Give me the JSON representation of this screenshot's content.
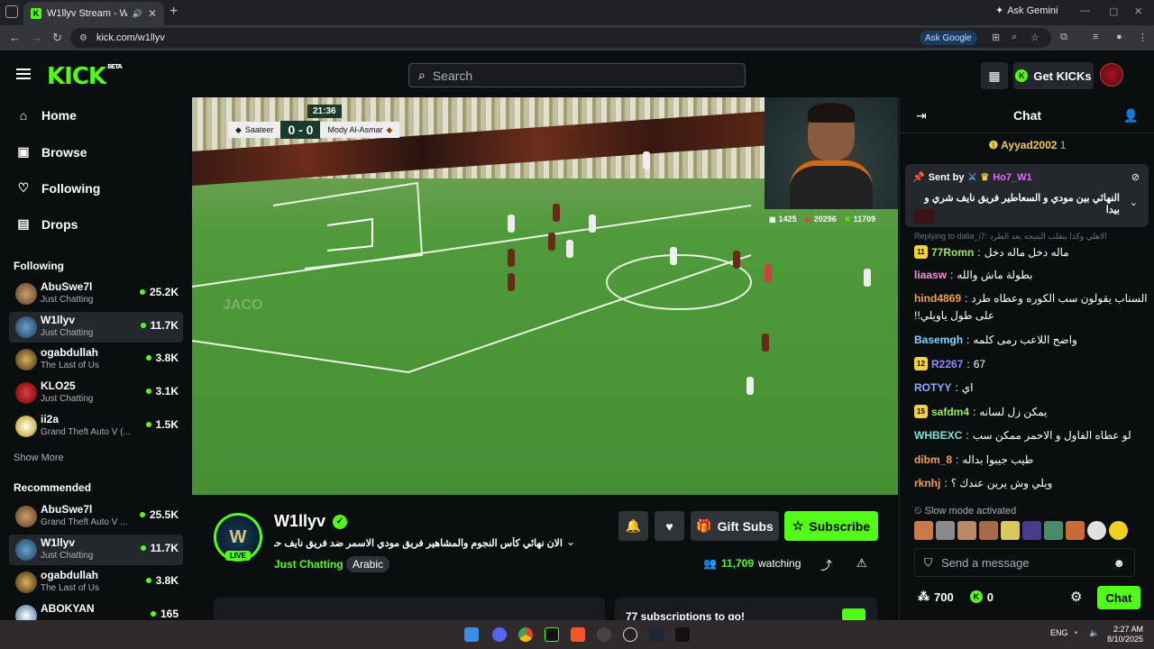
{
  "browser": {
    "tab_title": "W1llyv Stream - Watch Live",
    "ask_gemini": "Ask Gemini",
    "url": "kick.com/w1llyv",
    "ask_google": "Ask Google"
  },
  "header": {
    "logo": "KICK",
    "logo_beta": "BETA",
    "search_placeholder": "Search",
    "get_kicks": "Get KICKs"
  },
  "sidebar": {
    "nav": [
      {
        "label": "Home",
        "icon": "home-icon"
      },
      {
        "label": "Browse",
        "icon": "browse-icon"
      },
      {
        "label": "Following",
        "icon": "heart-icon"
      },
      {
        "label": "Drops",
        "icon": "drops-icon"
      }
    ],
    "following_title": "Following",
    "following": [
      {
        "name": "AbuSwe7l",
        "category": "Just Chatting",
        "viewers": "25.2K"
      },
      {
        "name": "W1llyv",
        "category": "Just Chatting",
        "viewers": "11.7K"
      },
      {
        "name": "ogabdullah",
        "category": "The Last of Us",
        "viewers": "3.8K"
      },
      {
        "name": "KLO25",
        "category": "Just Chatting",
        "viewers": "3.1K"
      },
      {
        "name": "ii2a",
        "category": "Grand Theft Auto V (...",
        "viewers": "1.5K"
      }
    ],
    "show_more": "Show More",
    "recommended_title": "Recommended",
    "recommended": [
      {
        "name": "AbuSwe7l",
        "category": "Grand Theft Auto V ...",
        "viewers": "25.5K"
      },
      {
        "name": "W1llyv",
        "category": "Just Chatting",
        "viewers": "11.7K"
      },
      {
        "name": "ogabdullah",
        "category": "The Last of Us",
        "viewers": "3.8K"
      },
      {
        "name": "ABOKYAN",
        "category": "",
        "viewers": "165"
      }
    ]
  },
  "video": {
    "clock": "21:36",
    "team_home": "Saateer",
    "score": "0 - 0",
    "team_away": "Mody Al-Asmar",
    "stat_1": "1425",
    "stat_2": "20296",
    "stat_3": "11709",
    "watermark": "JACO"
  },
  "stream": {
    "avatar_initial": "W",
    "live": "LIVE",
    "name": "W1llyv",
    "title": "الان نهائي كأس النجوم والمشاهير فريق مودي الاسمر ضد فريق نايف حمدان ...",
    "category": "Just Chatting",
    "tag": "Arabic",
    "gift_subs": "Gift Subs",
    "subscribe": "Subscribe",
    "viewers": "11,709",
    "watching_label": "watching",
    "panel_text": "77 subscriptions to go!"
  },
  "chat": {
    "title": "Chat",
    "top_gifter": "Ayyad2002",
    "top_gifter_count": "1",
    "pinned_sent_by": "Sent by",
    "pinned_user": "Ho7_W1",
    "pinned_msg": "النهائي بين مودي و السعاطير فريق نايف شري و بيدا",
    "reply_to": "Replying to dalia_i7: الاهلي وكذا بنقلب النتيجه بعد الطرد",
    "messages": [
      {
        "badge": "11",
        "user": "77Romn",
        "color": "#9be564",
        "text": "ماله دخل ماله دخل"
      },
      {
        "badge": "",
        "user": "liaasw",
        "color": "#ff8ad8",
        "text": "بطولة ماش والله"
      },
      {
        "badge": "",
        "user": "hind4869",
        "color": "#f0a04b",
        "text": "شفت السناب يقولون سب الكوره وعطاه طرد"
      },
      {
        "badge": "",
        "user": "",
        "color": "#ffffff",
        "text": "!!على طول ياويلي"
      },
      {
        "badge": "",
        "user": "Basemgh",
        "color": "#7fd3ff",
        "text": "واضح اللاعب رمى كلمه"
      },
      {
        "badge": "12",
        "user": "R2267",
        "color": "#8c8cff",
        "text": "67"
      },
      {
        "badge": "",
        "user": "ROTYY",
        "color": "#7fb0ff",
        "text": "اي"
      },
      {
        "badge": "15",
        "user": "safdm4",
        "color": "#9be564",
        "text": "يمكن زل لسانه"
      },
      {
        "badge": "",
        "user": "WHBEXC",
        "color": "#7fe0d6",
        "text": "لو عطاه الفاول و الاحمر ممكن سب"
      },
      {
        "badge": "",
        "user": "dibm_8",
        "color": "#f0a04b",
        "text": "طيب جيبوا بداله"
      },
      {
        "badge": "",
        "user": "rknhj",
        "color": "#f0a04b",
        "text": "ويلي وش يرين عندك ؟"
      }
    ],
    "slow_mode": "Slow mode activated",
    "input_placeholder": "Send a message",
    "points": "700",
    "kicks": "0",
    "chat_button": "Chat"
  },
  "taskbar": {
    "lang": "ENG",
    "time": "2:27 AM",
    "date": "8/10/2025"
  }
}
